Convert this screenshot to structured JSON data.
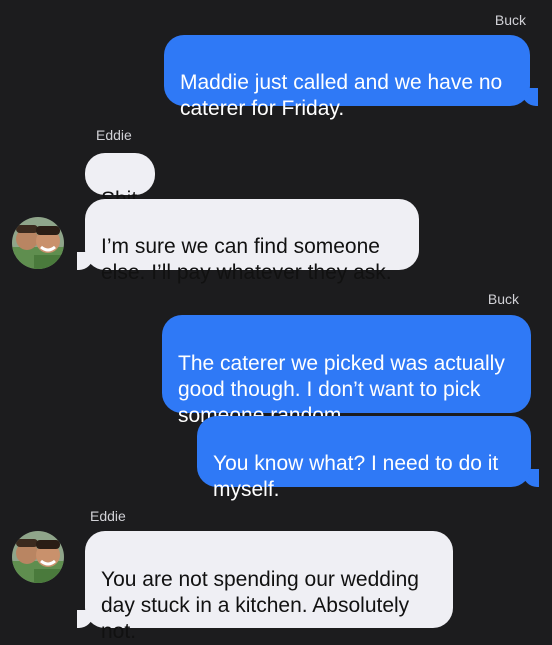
{
  "conversation": {
    "messages": [
      {
        "sender": "Buck",
        "direction": "outgoing",
        "text": "Maddie just called and we have no caterer for Friday."
      },
      {
        "sender": "Eddie",
        "direction": "incoming",
        "text": "Shit"
      },
      {
        "sender": "Eddie",
        "direction": "incoming",
        "text": "I’m sure we can find someone else. I’ll pay whatever they ask."
      },
      {
        "sender": "Buck",
        "direction": "outgoing",
        "text": "The caterer we picked was actually good though. I don’t want to pick someone random."
      },
      {
        "sender": "Buck",
        "direction": "outgoing",
        "text": "You know what? I need to do it myself."
      },
      {
        "sender": "Eddie",
        "direction": "incoming",
        "text": "You are not spending our wedding day stuck in a kitchen. Absolutely not."
      }
    ]
  },
  "colors": {
    "background": "#1c1c1e",
    "outgoing_bubble": "#2f79f6",
    "incoming_bubble": "#efeff4",
    "sender_label": "#d1d1d6"
  },
  "icons": {
    "avatar": "contact-photo-avatar"
  }
}
